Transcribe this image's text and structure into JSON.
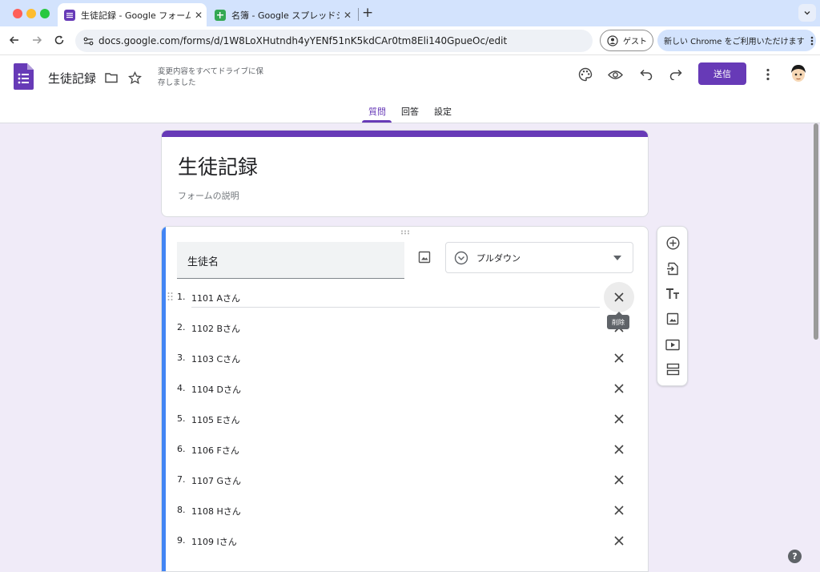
{
  "browser": {
    "tabs": [
      {
        "title": "生徒記録 - Google フォーム",
        "close": "✕"
      },
      {
        "title": "名簿 - Google スプレッドシート",
        "close": "✕"
      }
    ],
    "new_tab": "+",
    "url": "docs.google.com/forms/d/1W8LoXHutndh4yYENf51nK5kdCAr0tm8Eli140GpueOc/edit",
    "guest_label": "ゲスト",
    "promo_label": "新しい Chrome をご利用いただけます"
  },
  "forms_header": {
    "doc_title": "生徒記録",
    "save_status": "変更内容をすべてドライブに保存しました",
    "send_label": "送信",
    "tabs": [
      "質問",
      "回答",
      "設定"
    ],
    "active_tab": "質問"
  },
  "form": {
    "title": "生徒記録",
    "description": "フォームの説明"
  },
  "question": {
    "name": "生徒名",
    "type": "プルダウン",
    "options": [
      {
        "num": "1.",
        "text": "1101 Aさん"
      },
      {
        "num": "2.",
        "text": "1102 Bさん"
      },
      {
        "num": "3.",
        "text": "1103 Cさん"
      },
      {
        "num": "4.",
        "text": "1104 Dさん"
      },
      {
        "num": "5.",
        "text": "1105 Eさん"
      },
      {
        "num": "6.",
        "text": "1106 Fさん"
      },
      {
        "num": "7.",
        "text": "1107 Gさん"
      },
      {
        "num": "8.",
        "text": "1108 Hさん"
      },
      {
        "num": "9.",
        "text": "1109 Iさん"
      }
    ],
    "delete_tooltip": "削除"
  },
  "help_label": "?",
  "colors": {
    "accent": "#673ab7",
    "question_bar": "#4285f4",
    "page_bg": "#f0ebf8",
    "tabstrip": "#d3e3fd"
  },
  "icons": [
    "forms-logo-icon",
    "folder-icon",
    "star-icon",
    "palette-icon",
    "eye-icon",
    "undo-icon",
    "redo-icon",
    "more-vert-icon",
    "image-icon",
    "dropdown-circle-icon",
    "caret-down-icon",
    "close-icon",
    "add-circle-icon",
    "import-icon",
    "title-icon",
    "add-image-icon",
    "video-icon",
    "section-icon"
  ]
}
